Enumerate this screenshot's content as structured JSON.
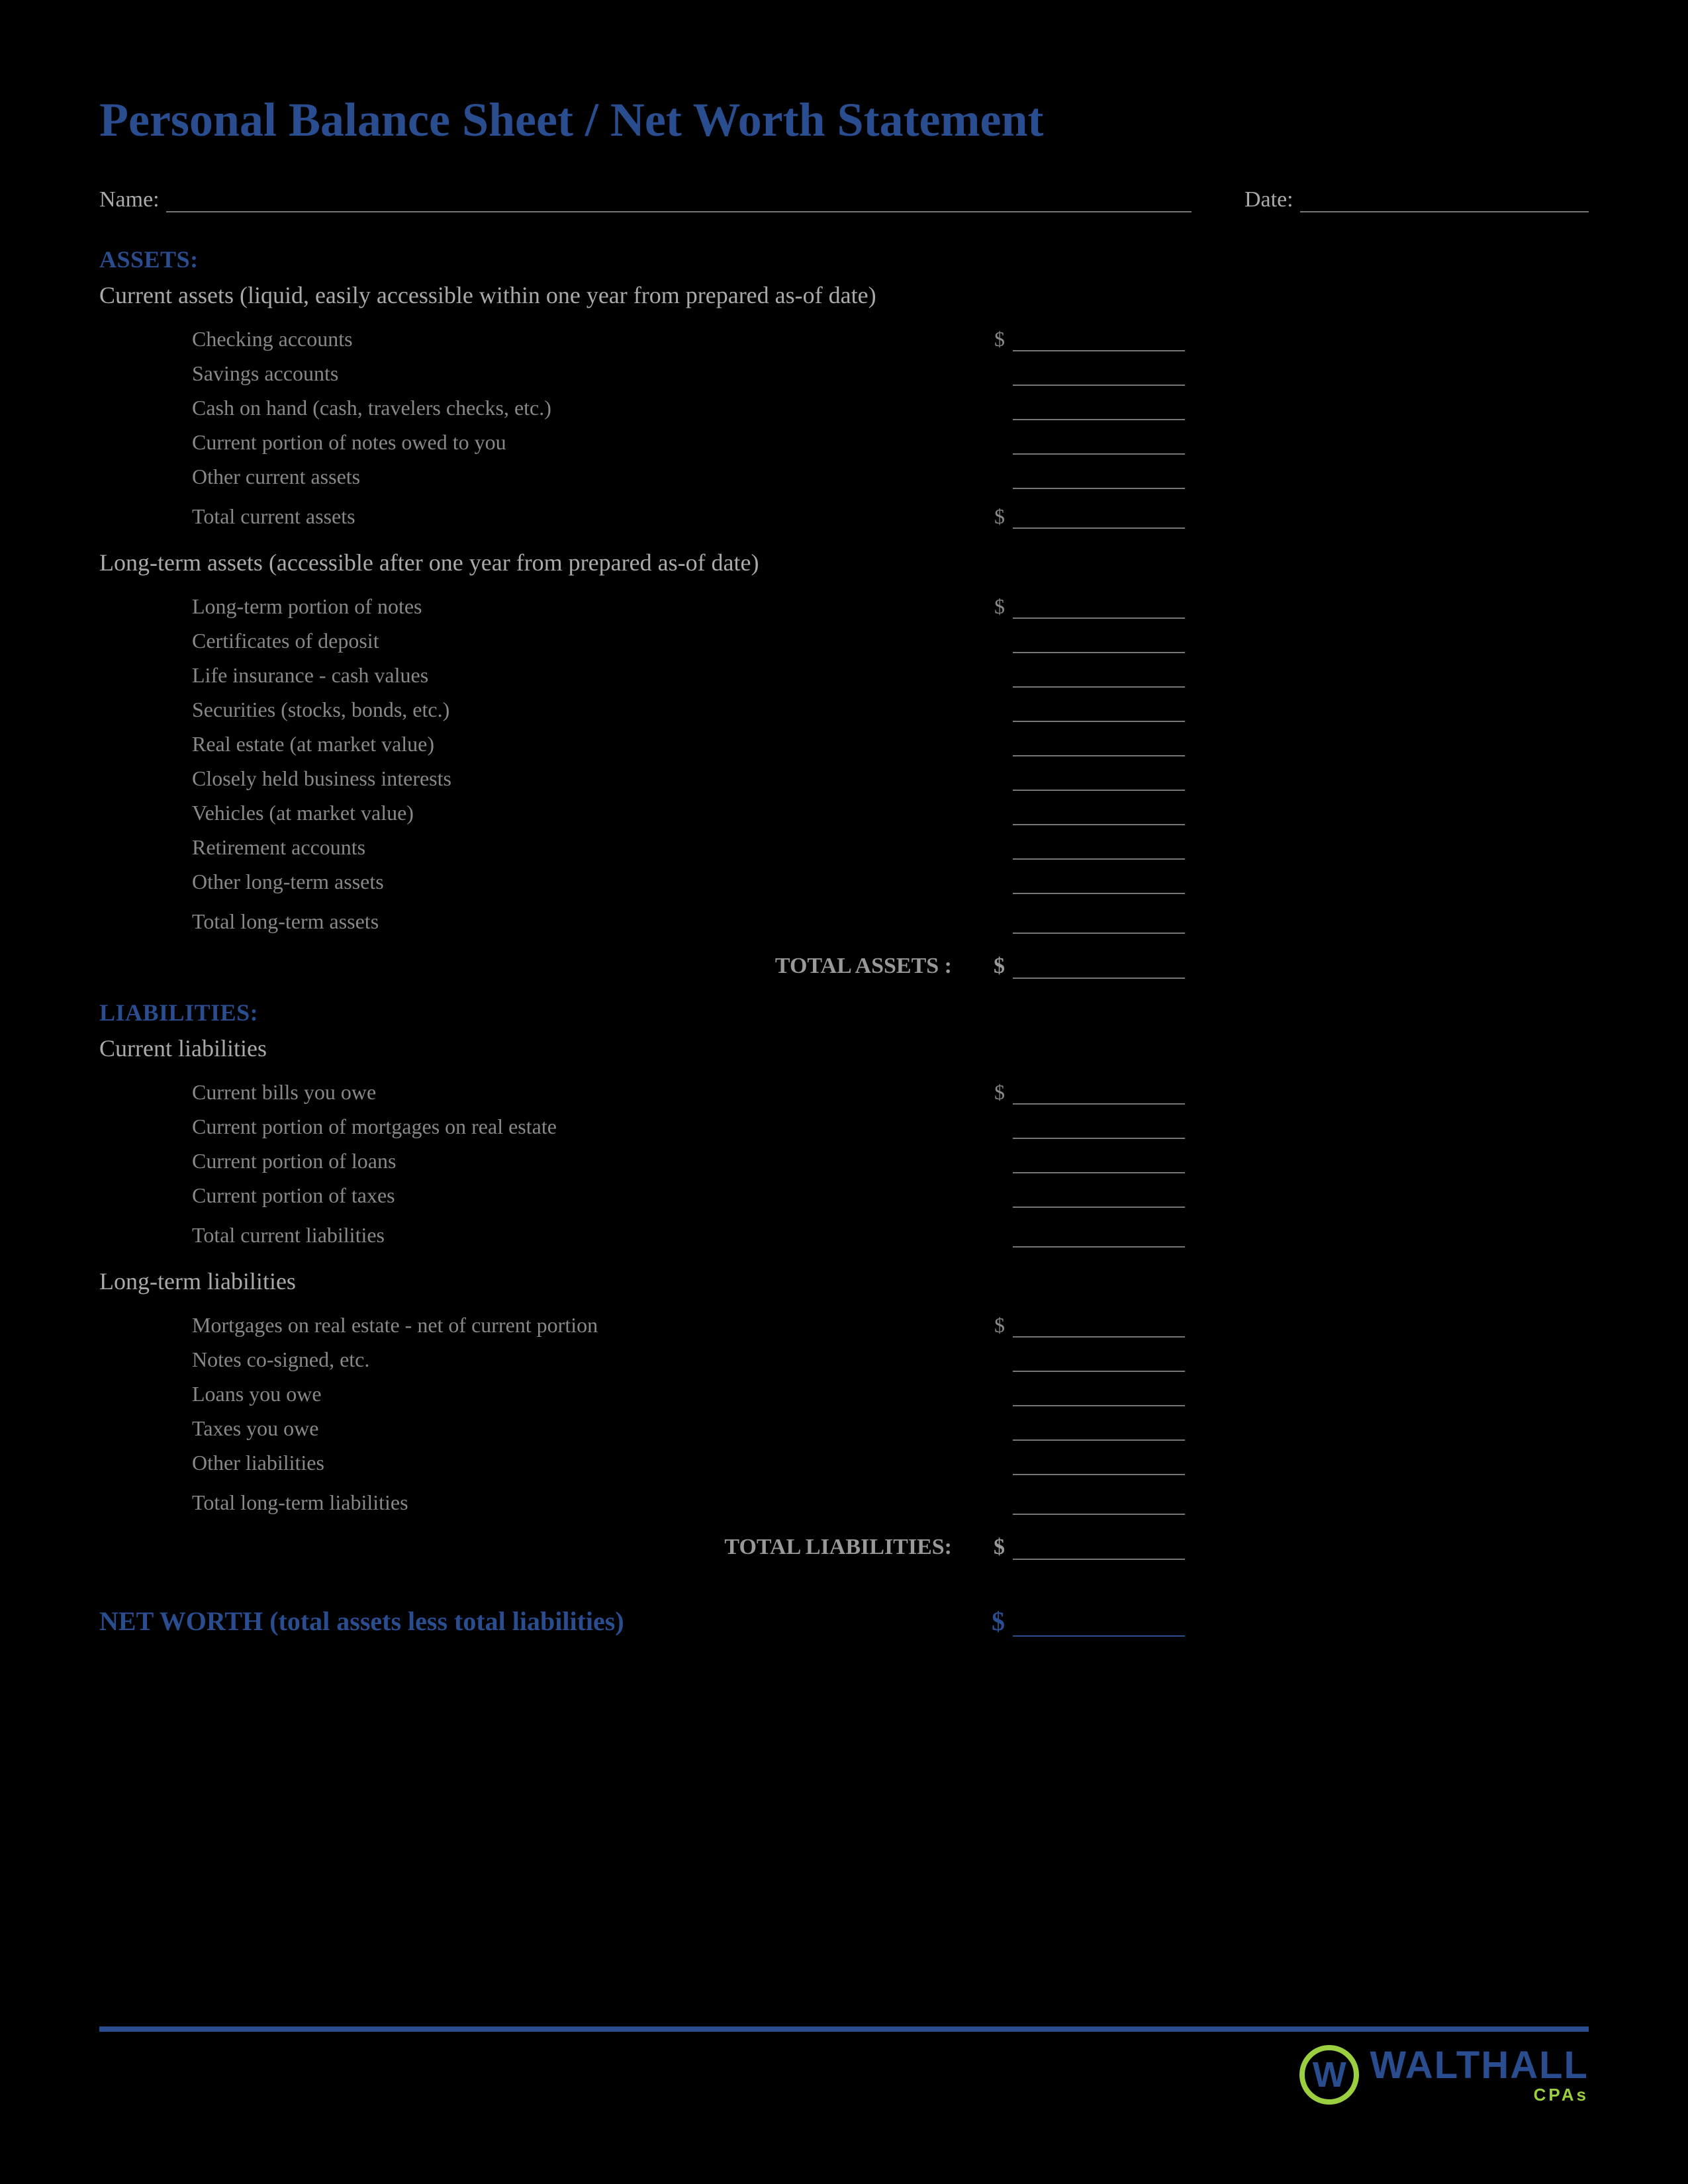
{
  "title": "Personal Balance Sheet / Net Worth Statement",
  "header": {
    "name_label": "Name:",
    "date_label": "Date:"
  },
  "assets": {
    "heading": "ASSETS:",
    "current": {
      "subtitle": "Current assets (liquid, easily accessible within one year from prepared as-of date)",
      "items": [
        "Checking accounts",
        "Savings accounts",
        "Cash on hand (cash, travelers checks, etc.)",
        "Current portion of notes owed to you",
        "Other current assets"
      ],
      "total_label": "Total current assets"
    },
    "longterm": {
      "subtitle": "Long-term assets (accessible after one year from prepared as-of date)",
      "items": [
        "Long-term portion of notes",
        "Certificates of deposit",
        "Life insurance - cash values",
        "Securities (stocks, bonds, etc.)",
        "Real estate (at market value)",
        "Closely held business interests",
        "Vehicles (at market value)",
        "Retirement accounts",
        "Other long-term assets"
      ],
      "total_label": "Total long-term assets"
    },
    "grand_total_label": "TOTAL ASSETS :"
  },
  "liabilities": {
    "heading": "LIABILITIES:",
    "current": {
      "subtitle": "Current liabilities",
      "items": [
        "Current bills you owe",
        "Current portion of mortgages on real estate",
        "Current portion of loans",
        "Current portion of taxes"
      ],
      "total_label": "Total current liabilities"
    },
    "longterm": {
      "subtitle": "Long-term liabilities",
      "items": [
        "Mortgages on real estate - net of current portion",
        "Notes co-signed, etc.",
        "Loans you owe",
        "Taxes you owe",
        "Other liabilities"
      ],
      "total_label": "Total long-term liabilities"
    },
    "grand_total_label": "TOTAL LIABILITIES:"
  },
  "networth_label": "NET WORTH (total assets less total liabilities)",
  "currency": "$",
  "logo": {
    "main": "WALTHALL",
    "sub": "CPAs",
    "mark": "W"
  }
}
